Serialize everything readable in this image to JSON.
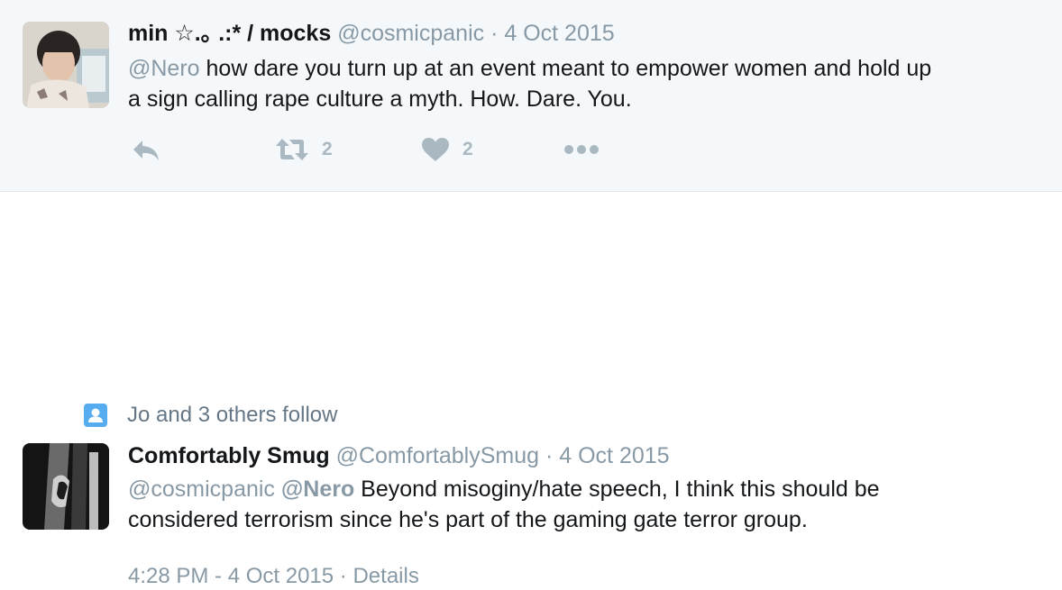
{
  "parent_tweet": {
    "fullname": "min ☆.｡ .:* / mocks",
    "username": "@cosmicpanic",
    "separator": "·",
    "date": "4 Oct 2015",
    "mention": "@Nero",
    "text_line1": " how dare you turn up at an event meant to empower women and hold up",
    "text_line2": "a sign calling rape culture a myth. How. Dare. You.",
    "retweet_count": "2",
    "like_count": "2",
    "icons": [
      "reply-icon",
      "retweet-icon",
      "heart-icon",
      "more-icon"
    ]
  },
  "social_context": {
    "text": "Jo and 3 others follow",
    "icon": "user-follow-icon"
  },
  "main_tweet": {
    "fullname": "Comfortably Smug",
    "username": "@ComfortablySmug",
    "separator": "·",
    "date": "4 Oct 2015",
    "mention1": "@cosmicpanic",
    "mention2": "@Nero",
    "text_line1": " Beyond misoginy/hate speech, I think this should be",
    "text_line2": "considered terrorism since he's part of the gaming gate terror group.",
    "timestamp": "4:28 PM - 4 Oct 2015",
    "details_separator": "·",
    "details_label": "Details"
  },
  "colors": {
    "parent_bg": "#f5f8fa",
    "muted_text": "#8899a6",
    "action_icon": "#aab8c2",
    "accent": "#55acee"
  }
}
